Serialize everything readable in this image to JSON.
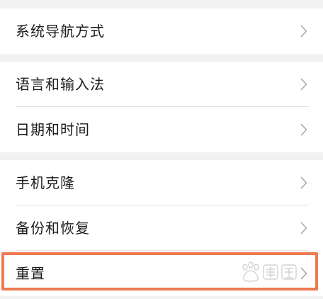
{
  "settings": {
    "group1": {
      "items": [
        {
          "label": "系统导航方式"
        }
      ]
    },
    "group2": {
      "items": [
        {
          "label": "语言和输入法"
        },
        {
          "label": "日期和时间"
        }
      ]
    },
    "group3": {
      "items": [
        {
          "label": "手机克隆"
        },
        {
          "label": "备份和恢复"
        },
        {
          "label": "重置"
        }
      ]
    }
  },
  "highlight": {
    "color": "#ee7a4f"
  },
  "watermark": {
    "logo": "baidu-jingyan-logo"
  },
  "colors": {
    "background": "#f2f2f2",
    "row_background": "#ffffff",
    "text": "#1b1b1b",
    "chevron": "#a8a8a8",
    "divider": "#e3e3e3"
  }
}
